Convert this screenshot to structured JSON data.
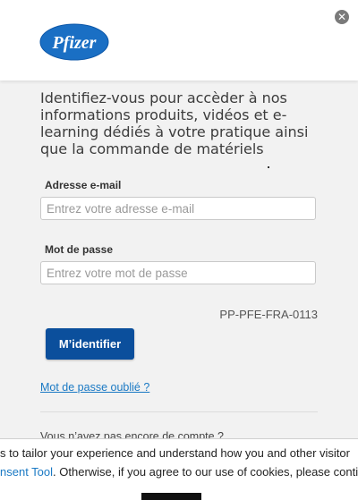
{
  "header": {
    "logo_text": "Pfizer",
    "close_symbol": "✕"
  },
  "intro": {
    "text": "Identifiez-vous pour accèder à nos informations produits, vidéos et e-learning dédiés à votre pratique ainsi que la commande de matériels"
  },
  "form": {
    "email_label": "Adresse e-mail",
    "email_placeholder": "Entrez votre adresse e-mail",
    "password_label": "Mot de passe",
    "password_placeholder": "Entrez votre mot de passe",
    "reference_code": "PP-PFE-FRA-0113",
    "submit_label": "M’identifier",
    "forgot_link": "Mot de passe oublié ?",
    "no_account_text": "Vous n’avez pas encore de compte ?"
  },
  "cookie_banner": {
    "line1": "s to tailor your experience and understand how you and other visitor",
    "line2_link": "nsent Tool",
    "line2_rest": ". Otherwise, if you agree to our use of cookies, please contin"
  },
  "colors": {
    "brand_blue": "#0b4f9c",
    "link_blue": "#1a79c4"
  },
  "icons": {
    "close": "close-icon",
    "logo": "pfizer-logo"
  }
}
